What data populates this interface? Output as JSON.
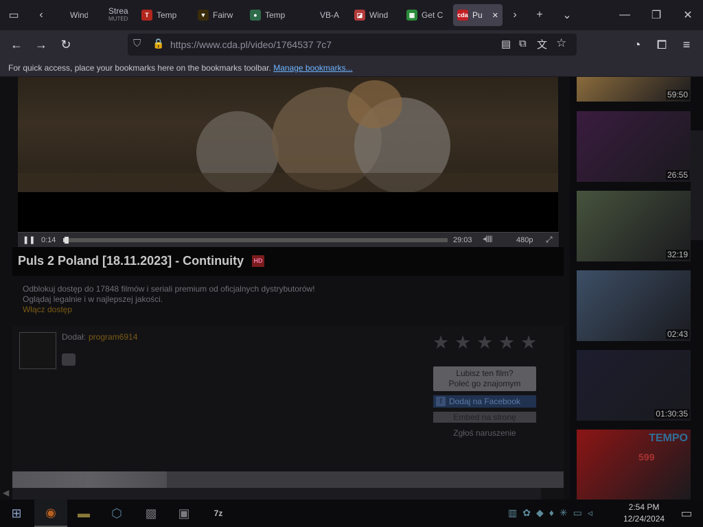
{
  "browser": {
    "tabs": [
      {
        "label": "Wind",
        "icon": "",
        "color": "#1c1b22"
      },
      {
        "label": "Strea",
        "sub": "MUTED",
        "icon": "",
        "color": "#b5532a"
      },
      {
        "label": "Temp",
        "icon": "T",
        "color": "#b3261e"
      },
      {
        "label": "Fairw",
        "icon": "▼",
        "color": "#3a2c0a"
      },
      {
        "label": "Temp",
        "icon": "●",
        "color": "#2e6b4a"
      },
      {
        "label": "VB-A",
        "icon": "",
        "color": "#1c1b22"
      },
      {
        "label": "Wind",
        "icon": "◪",
        "color": "#b23a3a"
      },
      {
        "label": "Get C",
        "icon": "▦",
        "color": "#2a8a3a"
      },
      {
        "label": "Pu",
        "icon": "cda",
        "color": "#c11f24"
      }
    ],
    "url": "https://www.cda.pl/video/1764537 7c7",
    "bookmarks_text": "For quick access, place your bookmarks here on the bookmarks toolbar.",
    "bookmarks_link": "Manage bookmarks..."
  },
  "video": {
    "current_time": "0:14",
    "duration": "29:03",
    "quality": "480p",
    "progress": 0.008,
    "title": "Puls 2 Poland [18.11.2023] - Continuity",
    "badge": "HD"
  },
  "promo": {
    "line1": "Odblokuj dostęp do 17848 filmów i seriali premium od oficjalnych dystrybutorów!",
    "line2": "Oglądaj legalnie i w najlepszej jakości.",
    "link": "Włącz dostęp"
  },
  "uploader": {
    "label": "Dodał:",
    "name": "program6914"
  },
  "rating": {
    "stars": 5
  },
  "share": {
    "recommend_line1": "Lubisz ten film?",
    "recommend_line2": "Poleć go znajomym",
    "facebook": "Dodaj na Facebook",
    "embed": "Embed na stronę",
    "report": "Zgłoś naruszenie"
  },
  "sidebar": {
    "thumbs": [
      {
        "duration": "59:50",
        "color": "#8a6b3c"
      },
      {
        "duration": "26:55",
        "color": "#3a1c3f"
      },
      {
        "duration": "32:19",
        "color": "#47533d"
      },
      {
        "duration": "02:43",
        "color": "#3d4f66"
      },
      {
        "duration": "01:30:35",
        "color": "#1c1d2e"
      },
      {
        "duration": "",
        "color": "#8c1515",
        "brand": "TEMPO",
        "price": "599"
      }
    ]
  },
  "taskbar": {
    "time": "2:54 PM",
    "date": "12/24/2024"
  }
}
